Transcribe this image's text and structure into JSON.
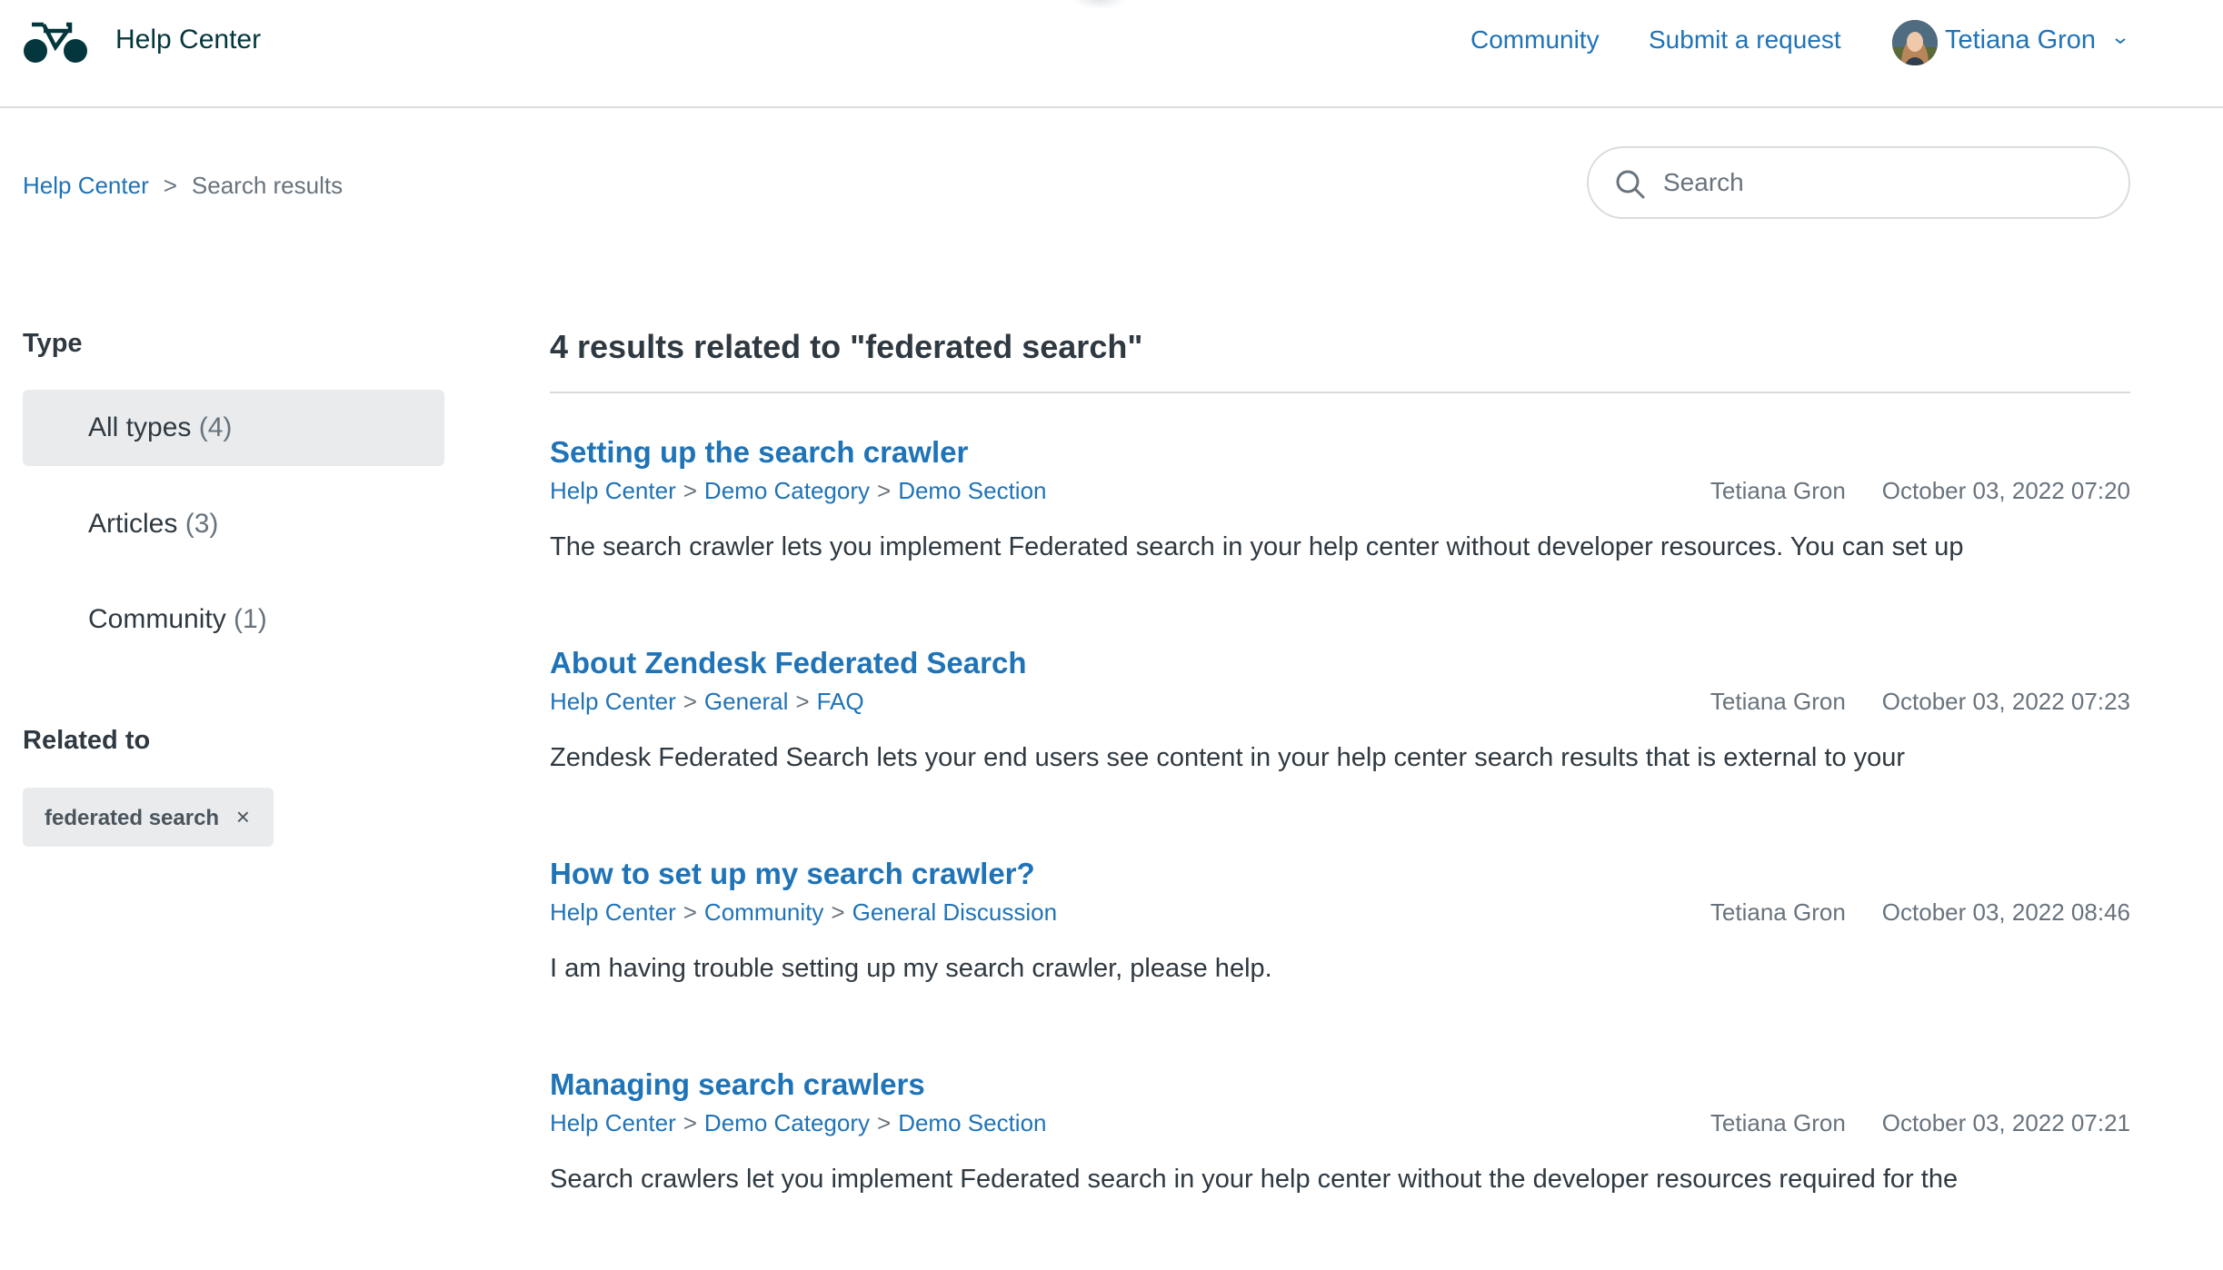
{
  "header": {
    "brand": "Help Center",
    "nav": [
      {
        "label": "Community"
      },
      {
        "label": "Submit a request"
      }
    ],
    "user": {
      "name": "Tetiana Gron"
    }
  },
  "breadcrumb": {
    "items": [
      "Help Center",
      "Search results"
    ],
    "separator": ">"
  },
  "search": {
    "placeholder": "Search",
    "value": ""
  },
  "sidebar": {
    "type_heading": "Type",
    "filters": [
      {
        "label": "All types",
        "count": "(4)",
        "active": true
      },
      {
        "label": "Articles",
        "count": "(3)",
        "active": false
      },
      {
        "label": "Community",
        "count": "(1)",
        "active": false
      }
    ],
    "related_heading": "Related to",
    "tags": [
      {
        "label": "federated search",
        "remove": "×"
      }
    ]
  },
  "results": {
    "heading": "4 results related to \"federated search\"",
    "path_separator": ">",
    "items": [
      {
        "title": "Setting up the search crawler",
        "path": [
          "Help Center",
          "Demo Category",
          "Demo Section"
        ],
        "author": "Tetiana Gron",
        "date": "October 03, 2022 07:20",
        "excerpt": "The search crawler lets you implement Federated search in your help center without developer resources. You can set up"
      },
      {
        "title": "About Zendesk Federated Search",
        "path": [
          "Help Center",
          "General",
          "FAQ"
        ],
        "author": "Tetiana Gron",
        "date": "October 03, 2022 07:23",
        "excerpt": "Zendesk Federated Search lets your end users see content in your help center search results that is external to your"
      },
      {
        "title": "How to set up my search crawler?",
        "path": [
          "Help Center",
          "Community",
          "General Discussion"
        ],
        "author": "Tetiana Gron",
        "date": "October 03, 2022 08:46",
        "excerpt": "I am having trouble setting up my search crawler, please help."
      },
      {
        "title": "Managing search crawlers",
        "path": [
          "Help Center",
          "Demo Category",
          "Demo Section"
        ],
        "author": "Tetiana Gron",
        "date": "October 03, 2022 07:21",
        "excerpt": "Search crawlers let you implement Federated search in your help center without the developer resources required for the"
      }
    ]
  },
  "colors": {
    "link": "#1f73b7",
    "text": "#2f3941",
    "muted": "#68737d",
    "brand": "#03363d",
    "active_filter_bg": "#e9ebed",
    "border": "#d8dcde"
  },
  "icons": {
    "logo": "bicycle-logo-icon",
    "search": "search-icon",
    "chevron": "chevron-down-icon",
    "tag_remove": "close-icon"
  }
}
